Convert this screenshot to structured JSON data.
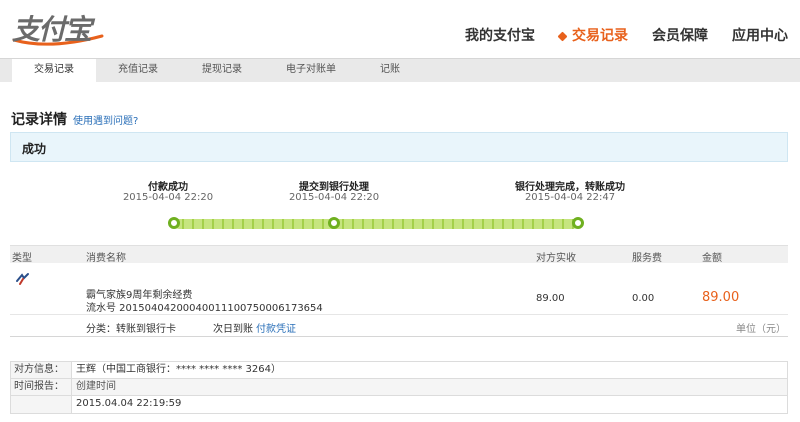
{
  "header": {
    "logo_text": "支付宝",
    "nav": [
      {
        "label": "我的支付宝",
        "active": false
      },
      {
        "label": "交易记录",
        "active": true
      },
      {
        "label": "会员保障",
        "active": false
      },
      {
        "label": "应用中心",
        "active": false
      }
    ]
  },
  "sub_nav": [
    {
      "label": "交易记录",
      "active": true
    },
    {
      "label": "充值记录",
      "active": false
    },
    {
      "label": "提现记录",
      "active": false
    },
    {
      "label": "电子对账单",
      "active": false
    },
    {
      "label": "记账",
      "active": false
    }
  ],
  "record": {
    "title": "记录详情",
    "help_link": "使用遇到问题?",
    "status": "成功"
  },
  "progress": [
    {
      "label": "付款成功",
      "time": "2015-04-04 22:20"
    },
    {
      "label": "提交到银行处理",
      "time": "2015-04-04 22:20"
    },
    {
      "label": "银行处理完成，转账成功",
      "time": "2015-04-04 22:47"
    }
  ],
  "table": {
    "headers": {
      "type": "类型",
      "name": "消费名称",
      "paid": "对方实收",
      "fee": "服务费",
      "amount": "金额"
    },
    "row": {
      "name": "霸气家族9周年剩余经费",
      "flow": "流水号 20150404200040011100750006173654",
      "paid": "89.00",
      "fee": "0.00",
      "amount": "89.00"
    },
    "meta": {
      "category": "分类：转账到银行卡",
      "arrival": "次日到账",
      "voucher": "付款凭证"
    }
  },
  "unit_note": "单位（元）",
  "info": {
    "party_label": "对方信息：",
    "party_value": "王辉（中国工商银行：**** **** **** 3264）",
    "time_label": "时间报告：",
    "time_sub": "创建时间",
    "time_value": "2015.04.04 22:19:59"
  },
  "colors": {
    "accent": "#e8611c",
    "link": "#2a6fb8",
    "progress_green": "#6fb020"
  }
}
